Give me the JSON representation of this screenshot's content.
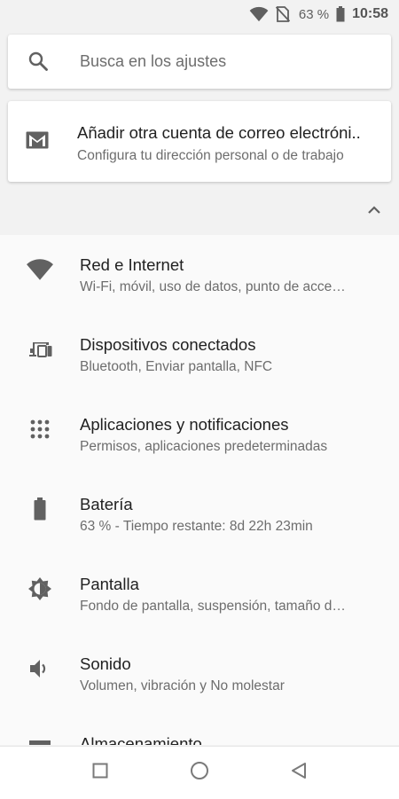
{
  "status_bar": {
    "battery_percent": "63 %",
    "time": "10:58",
    "icons": [
      "wifi-icon",
      "no-sim-icon",
      "battery-icon"
    ]
  },
  "search": {
    "placeholder": "Busca en los ajustes",
    "icon": "search-icon"
  },
  "suggestion": {
    "title": "Añadir otra cuenta de correo electróni..",
    "subtitle": "Configura tu dirección personal o de trabajo",
    "icon": "gmail-icon"
  },
  "collapse": {
    "icon": "chevron-up-icon"
  },
  "settings": [
    {
      "title": "Red e Internet",
      "summary": "Wi-Fi, móvil, uso de datos, punto de acce…",
      "icon": "wifi-icon"
    },
    {
      "title": "Dispositivos conectados",
      "summary": "Bluetooth, Enviar pantalla, NFC",
      "icon": "connected-devices-icon"
    },
    {
      "title": "Aplicaciones y notificaciones",
      "summary": "Permisos, aplicaciones predeterminadas",
      "icon": "apps-grid-icon"
    },
    {
      "title": "Batería",
      "summary": "63 % - Tiempo restante: 8d 22h 23min",
      "icon": "battery-icon"
    },
    {
      "title": "Pantalla",
      "summary": "Fondo de pantalla, suspensión, tamaño d…",
      "icon": "brightness-icon"
    },
    {
      "title": "Sonido",
      "summary": "Volumen, vibración y No molestar",
      "icon": "volume-icon"
    },
    {
      "title": "Almacenamiento",
      "summary": "",
      "icon": "storage-icon"
    }
  ],
  "navigation": [
    "recents-button",
    "home-button",
    "back-button"
  ],
  "colors": {
    "background": "#f2f2f2",
    "list_background": "#fafafa",
    "icon": "#616161",
    "primary_text": "#212121",
    "secondary_text": "#6d6d6d"
  }
}
